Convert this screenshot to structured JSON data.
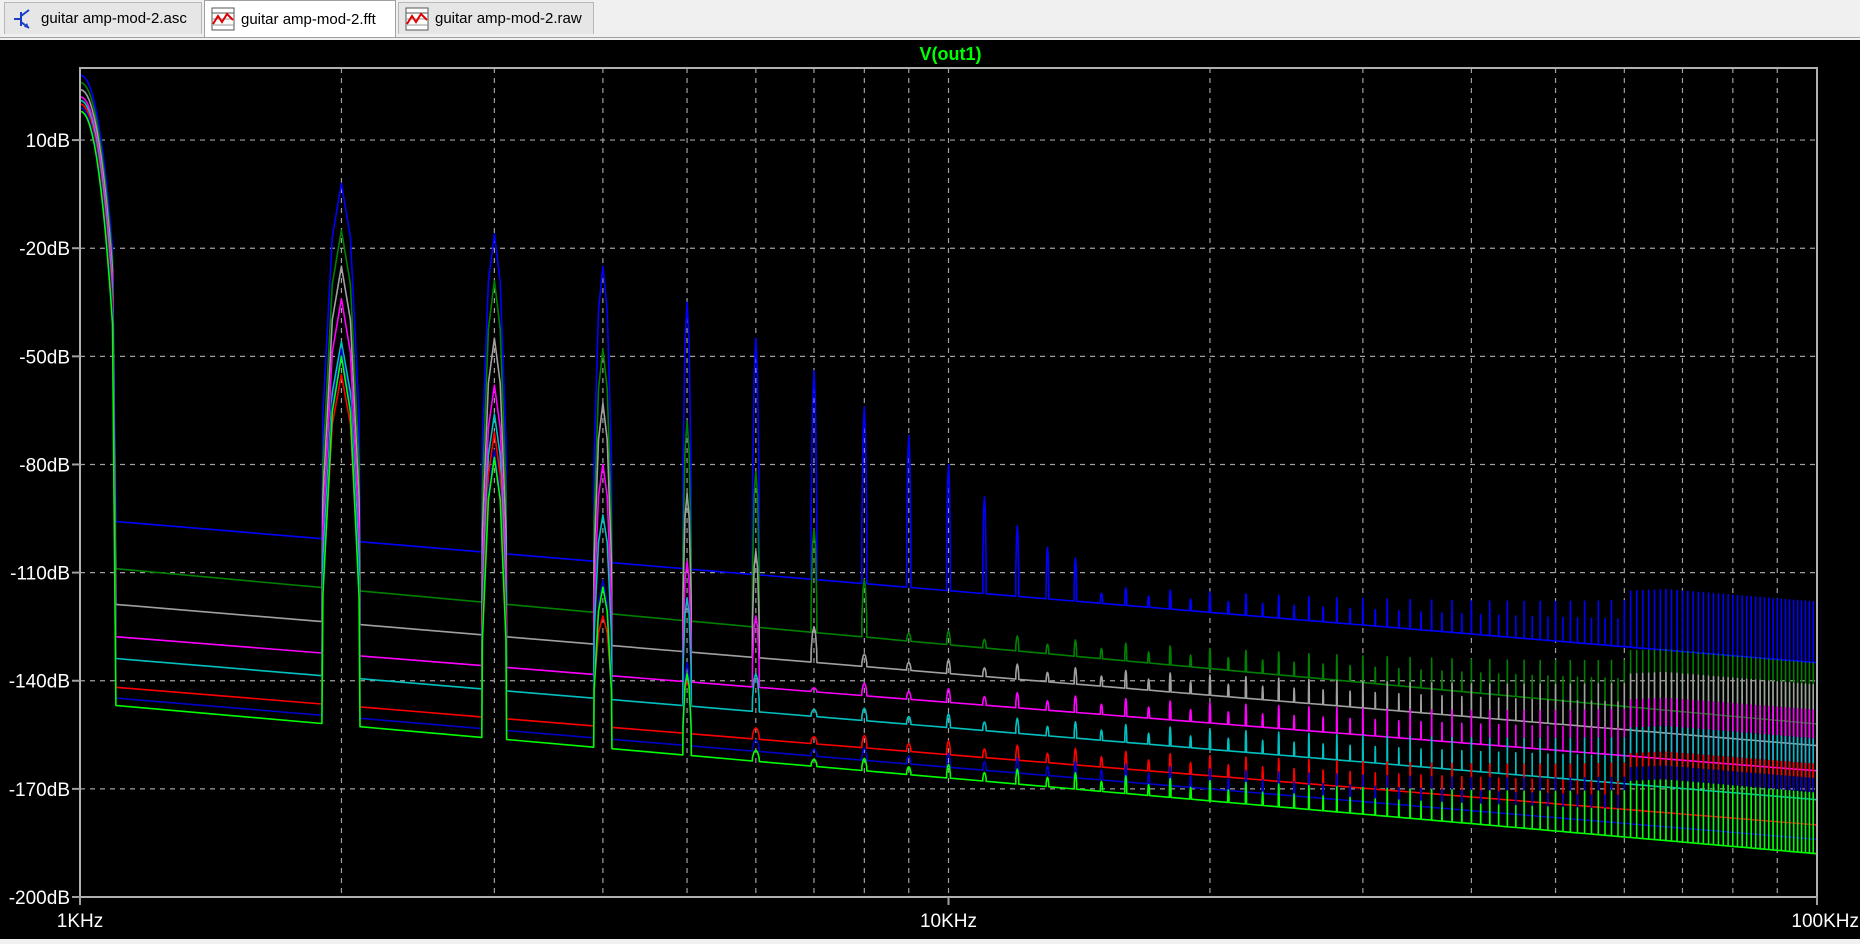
{
  "tabs": [
    {
      "label": "guitar amp-mod-2.asc",
      "icon": "schematic-icon",
      "active": false
    },
    {
      "label": "guitar amp-mod-2.fft",
      "icon": "waveform-icon",
      "active": true
    },
    {
      "label": "guitar amp-mod-2.raw",
      "icon": "waveform-icon",
      "active": false
    }
  ],
  "colors": {
    "background": "#000000",
    "grid": "#a0a0a0",
    "axis_text": "#ffffff",
    "title": "#00ff00"
  },
  "chart_data": {
    "type": "line",
    "title": "V(out1)",
    "xscale": "log",
    "xlim": [
      1000,
      100000
    ],
    "ylim": [
      -200,
      30
    ],
    "grid": true,
    "xticks": [
      {
        "value": 1000,
        "label": "1KHz"
      },
      {
        "value": 10000,
        "label": "10KHz"
      },
      {
        "value": 100000,
        "label": "100KHz"
      }
    ],
    "yticks": [
      {
        "value": 10,
        "label": "10dB"
      },
      {
        "value": -20,
        "label": "-20dB"
      },
      {
        "value": -50,
        "label": "-50dB"
      },
      {
        "value": -80,
        "label": "-80dB"
      },
      {
        "value": -110,
        "label": "-110dB"
      },
      {
        "value": -140,
        "label": "-140dB"
      },
      {
        "value": -170,
        "label": "-170dB"
      },
      {
        "value": -200,
        "label": "-200dB"
      }
    ],
    "fundamental_hz": 1000,
    "series": [
      {
        "color": "#0000ff",
        "peak_db": 28,
        "floor_start_db": -95,
        "floor_end_db": -135,
        "harmonics": [
          [
            2000,
            -2
          ],
          [
            3000,
            -16
          ],
          [
            4000,
            -25
          ],
          [
            5000,
            -35
          ],
          [
            6000,
            -45
          ],
          [
            7000,
            -54
          ],
          [
            8000,
            -64
          ],
          [
            9000,
            -72
          ],
          [
            10000,
            -80
          ],
          [
            11000,
            -89
          ],
          [
            12000,
            -97
          ],
          [
            13000,
            -103
          ],
          [
            14000,
            -106
          ]
        ]
      },
      {
        "color": "#008000",
        "peak_db": 26,
        "floor_start_db": -108,
        "floor_end_db": -152,
        "harmonics": [
          [
            2000,
            -15
          ],
          [
            3000,
            -29
          ],
          [
            4000,
            -48
          ],
          [
            5000,
            -68
          ],
          [
            6000,
            -82
          ],
          [
            7000,
            -98
          ],
          [
            8000,
            -112
          ]
        ]
      },
      {
        "color": "#a0a0a0",
        "peak_db": 24,
        "floor_start_db": -118,
        "floor_end_db": -158,
        "harmonics": [
          [
            2000,
            -25
          ],
          [
            3000,
            -45
          ],
          [
            4000,
            -63
          ],
          [
            5000,
            -88
          ],
          [
            6000,
            -104
          ],
          [
            7000,
            -125
          ]
        ]
      },
      {
        "color": "#ff00ff",
        "peak_db": 22,
        "floor_start_db": -127,
        "floor_end_db": -165,
        "harmonics": [
          [
            2000,
            -34
          ],
          [
            3000,
            -58
          ],
          [
            4000,
            -80
          ],
          [
            5000,
            -107
          ],
          [
            6000,
            -122
          ],
          [
            7000,
            -142
          ]
        ]
      },
      {
        "color": "#00c0c0",
        "peak_db": 21,
        "floor_start_db": -133,
        "floor_end_db": -173,
        "harmonics": [
          [
            2000,
            -46
          ],
          [
            3000,
            -66
          ],
          [
            4000,
            -94
          ],
          [
            5000,
            -117
          ],
          [
            6000,
            -138
          ]
        ]
      },
      {
        "color": "#ff0000",
        "peak_db": 20,
        "floor_start_db": -141,
        "floor_end_db": -180,
        "harmonics": [
          [
            2000,
            -55
          ],
          [
            3000,
            -71
          ],
          [
            4000,
            -122
          ],
          [
            5000,
            -140
          ]
        ]
      },
      {
        "color": "#0000c8",
        "peak_db": 19,
        "floor_start_db": -144,
        "floor_end_db": -184,
        "harmonics": [
          [
            2000,
            -48
          ],
          [
            3000,
            -76
          ],
          [
            4000,
            -112
          ],
          [
            5000,
            -135
          ]
        ]
      },
      {
        "color": "#00ff00",
        "peak_db": 18,
        "floor_start_db": -146,
        "floor_end_db": -188,
        "harmonics": [
          [
            2000,
            -50
          ],
          [
            3000,
            -78
          ],
          [
            4000,
            -114
          ],
          [
            5000,
            -138
          ]
        ]
      }
    ]
  }
}
